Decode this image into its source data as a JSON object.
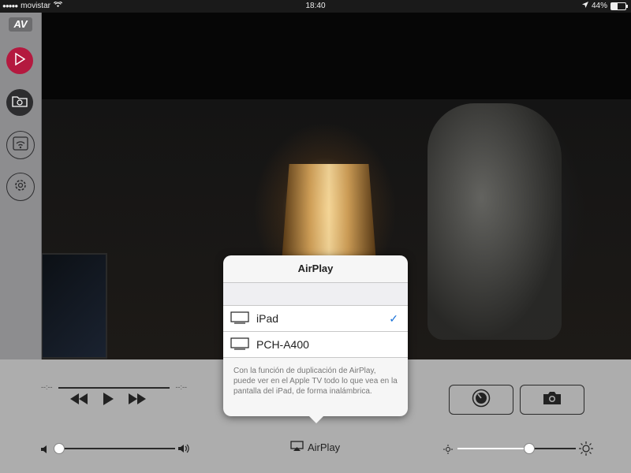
{
  "status_bar": {
    "carrier": "movistar",
    "time": "18:40",
    "battery_percent": "44%",
    "battery_level": 0.44
  },
  "sidebar": {
    "logo_text": "AV",
    "items": [
      {
        "icon": "play-icon"
      },
      {
        "icon": "camera-folder-icon"
      },
      {
        "icon": "wifi-share-icon"
      },
      {
        "icon": "gear-icon"
      }
    ]
  },
  "player": {
    "elapsed": "--:--",
    "remaining": "--:--",
    "volume_level": 0.0,
    "brightness_level": 0.6,
    "airplay_label": "AirPlay"
  },
  "airplay_popover": {
    "title": "AirPlay",
    "devices": [
      {
        "name": "iPad",
        "selected": true
      },
      {
        "name": "PCH-A400",
        "selected": false
      }
    ],
    "description": "Con la función de duplicación de AirPlay, puede ver en el Apple TV todo lo que vea en la pantalla del iPad, de forma inalámbrica."
  },
  "colors": {
    "accent_red": "#b4193f",
    "check_blue": "#1a72d8",
    "control_bar": "#adadad",
    "sidebar": "#8d8d8f"
  }
}
